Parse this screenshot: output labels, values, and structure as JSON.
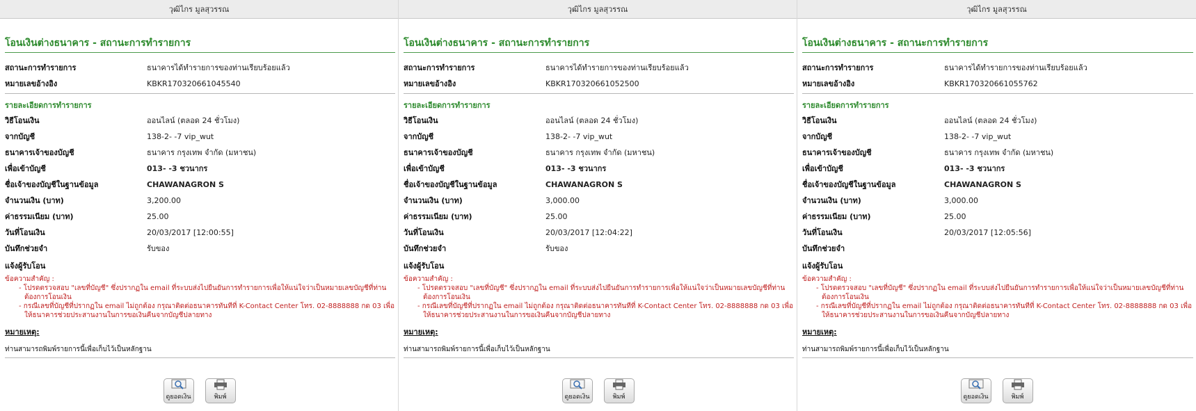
{
  "panels": [
    {
      "user_name": "วุฒิไกร มูลสุวรรณ",
      "title": "โอนเงินต่างธนาคาร - สถานะการทำรายการ",
      "status_label": "สถานะการทำรายการ",
      "status_value": "ธนาคารได้ทำรายการของท่านเรียบร้อยแล้ว",
      "ref_label": "หมายเลขอ้างอิง",
      "ref_value": "KBKR170320661045540",
      "details_title": "รายละเอียดการทำรายการ",
      "details": [
        {
          "label": "วิธีโอนเงิน",
          "value": "ออนไลน์ (ตลอด 24 ชั่วโมง)"
        },
        {
          "label": "จากบัญชี",
          "value": "138-2-          -7 vip_wut"
        },
        {
          "label": "ธนาคารเจ้าของบัญชี",
          "value": "ธนาคาร กรุงเทพ จำกัด (มหาชน)"
        },
        {
          "label": "เพื่อเข้าบัญชี",
          "value": "013-              -3 ชวนากร"
        },
        {
          "label": "ชื่อเจ้าของบัญชีในฐานข้อมูล",
          "value": "CHAWANAGRON S"
        },
        {
          "label": "จำนวนเงิน (บาท)",
          "value": "3,200.00"
        },
        {
          "label": "ค่าธรรมเนียม (บาท)",
          "value": "25.00"
        },
        {
          "label": "วันที่โอนเงิน",
          "value": "20/03/2017 [12:00:55]"
        },
        {
          "label": "บันทึกช่วยจำ",
          "value": "รับของ"
        }
      ],
      "notify_label": "แจ้งผู้รับโอน",
      "important_title": "ข้อความสำคัญ :",
      "important_items": [
        "- โปรดตรวจสอบ \"เลขที่บัญชี\" ซึ่งปรากฏใน email ที่ระบบส่งไปยืนยันการทำรายการเพื่อให้แน่ใจว่าเป็นหมายเลขบัญชีที่ท่านต้องการโอนเงิน",
        "- กรณีเลขที่บัญชีที่ปรากฏใน email ไม่ถูกต้อง กรุณาติดต่อธนาคารทันทีที่ K-Contact Center โทร. 02-8888888 กด 03 เพื่อให้ธนาคารช่วยประสานงานในการขอเงินคืนจากบัญชีปลายทาง"
      ],
      "note_title": "หมายเหตุ:",
      "note_text": "ท่านสามารถพิมพ์รายการนี้เพื่อเก็บไว้เป็นหลักฐาน",
      "btn_balance": "ดูยอดเงิน",
      "btn_print": "พิมพ์"
    },
    {
      "user_name": "วุฒิไกร มูลสุวรรณ",
      "title": "โอนเงินต่างธนาคาร - สถานะการทำรายการ",
      "status_label": "สถานะการทำรายการ",
      "status_value": "ธนาคารได้ทำรายการของท่านเรียบร้อยแล้ว",
      "ref_label": "หมายเลขอ้างอิง",
      "ref_value": "KBKR170320661052500",
      "details_title": "รายละเอียดการทำรายการ",
      "details": [
        {
          "label": "วิธีโอนเงิน",
          "value": "ออนไลน์ (ตลอด 24 ชั่วโมง)"
        },
        {
          "label": "จากบัญชี",
          "value": "138-2-          -7 vip_wut"
        },
        {
          "label": "ธนาคารเจ้าของบัญชี",
          "value": "ธนาคาร กรุงเทพ จำกัด (มหาชน)"
        },
        {
          "label": "เพื่อเข้าบัญชี",
          "value": "013-              -3 ชวนากร"
        },
        {
          "label": "ชื่อเจ้าของบัญชีในฐานข้อมูล",
          "value": "CHAWANAGRON S"
        },
        {
          "label": "จำนวนเงิน (บาท)",
          "value": "3,000.00"
        },
        {
          "label": "ค่าธรรมเนียม (บาท)",
          "value": "25.00"
        },
        {
          "label": "วันที่โอนเงิน",
          "value": "20/03/2017 [12:04:22]"
        },
        {
          "label": "บันทึกช่วยจำ",
          "value": "รับของ"
        }
      ],
      "notify_label": "แจ้งผู้รับโอน",
      "important_title": "ข้อความสำคัญ :",
      "important_items": [
        "- โปรดตรวจสอบ \"เลขที่บัญชี\" ซึ่งปรากฏใน email ที่ระบบส่งไปยืนยันการทำรายการเพื่อให้แน่ใจว่าเป็นหมายเลขบัญชีที่ท่านต้องการโอนเงิน",
        "- กรณีเลขที่บัญชีที่ปรากฏใน email ไม่ถูกต้อง กรุณาติดต่อธนาคารทันทีที่ K-Contact Center โทร. 02-8888888 กด 03 เพื่อให้ธนาคารช่วยประสานงานในการขอเงินคืนจากบัญชีปลายทาง"
      ],
      "note_title": "หมายเหตุ:",
      "note_text": "ท่านสามารถพิมพ์รายการนี้เพื่อเก็บไว้เป็นหลักฐาน",
      "btn_balance": "ดูยอดเงิน",
      "btn_print": "พิมพ์"
    },
    {
      "user_name": "วุฒิไกร มูลสุวรรณ",
      "title": "โอนเงินต่างธนาคาร - สถานะการทำรายการ",
      "status_label": "สถานะการทำรายการ",
      "status_value": "ธนาคารได้ทำรายการของท่านเรียบร้อยแล้ว",
      "ref_label": "หมายเลขอ้างอิง",
      "ref_value": "KBKR170320661055762",
      "details_title": "รายละเอียดการทำรายการ",
      "details": [
        {
          "label": "วิธีโอนเงิน",
          "value": "ออนไลน์ (ตลอด 24 ชั่วโมง)"
        },
        {
          "label": "จากบัญชี",
          "value": "138-2-          -7 vip_wut"
        },
        {
          "label": "ธนาคารเจ้าของบัญชี",
          "value": "ธนาคาร กรุงเทพ จำกัด (มหาชน)"
        },
        {
          "label": "เพื่อเข้าบัญชี",
          "value": "013-              -3 ชวนากร"
        },
        {
          "label": "ชื่อเจ้าของบัญชีในฐานข้อมูล",
          "value": "CHAWANAGRON S"
        },
        {
          "label": "จำนวนเงิน (บาท)",
          "value": "3,000.00"
        },
        {
          "label": "ค่าธรรมเนียม (บาท)",
          "value": "25.00"
        },
        {
          "label": "วันที่โอนเงิน",
          "value": "20/03/2017 [12:05:56]"
        },
        {
          "label": "บันทึกช่วยจำ",
          "value": ""
        }
      ],
      "notify_label": "แจ้งผู้รับโอน",
      "important_title": "ข้อความสำคัญ :",
      "important_items": [
        "- โปรดตรวจสอบ \"เลขที่บัญชี\" ซึ่งปรากฏใน email ที่ระบบส่งไปยืนยันการทำรายการเพื่อให้แน่ใจว่าเป็นหมายเลขบัญชีที่ท่านต้องการโอนเงิน",
        "- กรณีเลขที่บัญชีที่ปรากฏใน email ไม่ถูกต้อง กรุณาติดต่อธนาคารทันทีที่ K-Contact Center โทร. 02-8888888 กด 03 เพื่อให้ธนาคารช่วยประสานงานในการขอเงินคืนจากบัญชีปลายทาง"
      ],
      "note_title": "หมายเหตุ:",
      "note_text": "ท่านสามารถพิมพ์รายการนี้เพื่อเก็บไว้เป็นหลักฐาน",
      "btn_balance": "ดูยอดเงิน",
      "btn_print": "พิมพ์"
    }
  ]
}
